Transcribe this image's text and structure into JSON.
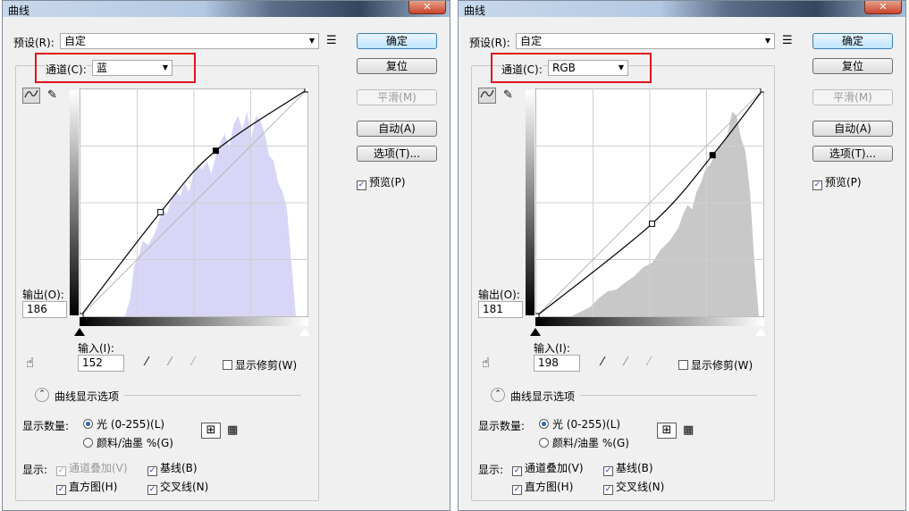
{
  "dialogs": [
    {
      "title": "曲线",
      "close_label": "✕",
      "preset_label": "预设(R):",
      "preset_value": "自定",
      "preset_menu_icon": "options-list-icon",
      "buttons": {
        "ok": "确定",
        "reset": "复位",
        "smooth": "平滑(M)",
        "auto": "自动(A)",
        "options": "选项(T)..."
      },
      "preview_label": "预览(P)",
      "preview_checked": true,
      "channel_label": "通道(C):",
      "channel_value": "蓝",
      "output_label": "输出(O):",
      "output_value": "186",
      "input_label": "输入(I):",
      "input_value": "152",
      "show_clipping_label": "显示修剪(W)",
      "curve_options_label": "曲线显示选项",
      "show_amount_label": "显示数量:",
      "radio_light": "光 (0-255)(L)",
      "radio_pigment": "颜料/油墨 %(G)",
      "show_label": "显示:",
      "chk_channel_overlay": "通道叠加(V)",
      "chk_baseline": "基线(B)",
      "chk_histogram": "直方图(H)",
      "chk_intersection": "交叉线(N)",
      "colors": {
        "histogram": "#d8d6f6",
        "channel_highlight": "#e0141e"
      },
      "chart_data": {
        "type": "area",
        "title": "",
        "xlim": [
          0,
          255
        ],
        "ylim": [
          0,
          255
        ],
        "histogram_x": [
          0,
          50,
          56,
          60,
          66,
          70,
          76,
          82,
          86,
          92,
          97,
          102,
          107,
          112,
          117,
          122,
          127,
          132,
          137,
          142,
          147,
          152,
          157,
          162,
          167,
          172,
          177,
          182,
          187,
          192,
          197,
          202,
          207,
          212,
          217,
          222,
          227,
          232,
          237,
          242,
          247,
          255
        ],
        "histogram_y": [
          0,
          0,
          20,
          55,
          70,
          85,
          80,
          90,
          100,
          120,
          115,
          130,
          140,
          135,
          150,
          140,
          160,
          170,
          165,
          175,
          160,
          180,
          195,
          205,
          190,
          215,
          225,
          210,
          230,
          200,
          225,
          220,
          205,
          180,
          175,
          150,
          140,
          120,
          60,
          0,
          0,
          0
        ],
        "curve_points": [
          [
            0,
            0
          ],
          [
            90,
            117
          ],
          [
            152,
            186
          ],
          [
            255,
            255
          ]
        ]
      }
    },
    {
      "title": "曲线",
      "close_label": "✕",
      "preset_label": "预设(R):",
      "preset_value": "自定",
      "preset_menu_icon": "options-list-icon",
      "buttons": {
        "ok": "确定",
        "reset": "复位",
        "smooth": "平滑(M)",
        "auto": "自动(A)",
        "options": "选项(T)..."
      },
      "preview_label": "预览(P)",
      "preview_checked": true,
      "channel_label": "通道(C):",
      "channel_value": "RGB",
      "output_label": "输出(O):",
      "output_value": "181",
      "input_label": "输入(I):",
      "input_value": "198",
      "show_clipping_label": "显示修剪(W)",
      "curve_options_label": "曲线显示选项",
      "show_amount_label": "显示数量:",
      "radio_light": "光 (0-255)(L)",
      "radio_pigment": "颜料/油墨 %(G)",
      "show_label": "显示:",
      "chk_channel_overlay": "通道叠加(V)",
      "chk_baseline": "基线(B)",
      "chk_histogram": "直方图(H)",
      "chk_intersection": "交叉线(N)",
      "colors": {
        "histogram": "#c8c8c8",
        "channel_highlight": "#e0141e"
      },
      "chart_data": {
        "type": "area",
        "title": "",
        "xlim": [
          0,
          255
        ],
        "ylim": [
          0,
          255
        ],
        "histogram_x": [
          0,
          40,
          50,
          60,
          70,
          80,
          90,
          100,
          110,
          120,
          130,
          140,
          150,
          160,
          165,
          170,
          175,
          180,
          185,
          190,
          195,
          200,
          205,
          210,
          215,
          220,
          225,
          230,
          235,
          240,
          245,
          250,
          255
        ],
        "histogram_y": [
          0,
          0,
          5,
          10,
          20,
          28,
          30,
          38,
          45,
          55,
          60,
          75,
          85,
          100,
          115,
          125,
          120,
          140,
          150,
          165,
          170,
          180,
          190,
          195,
          205,
          230,
          225,
          200,
          185,
          140,
          60,
          0,
          0
        ],
        "curve_points": [
          [
            0,
            0
          ],
          [
            130,
            104
          ],
          [
            198,
            181
          ],
          [
            255,
            255
          ]
        ]
      }
    }
  ]
}
